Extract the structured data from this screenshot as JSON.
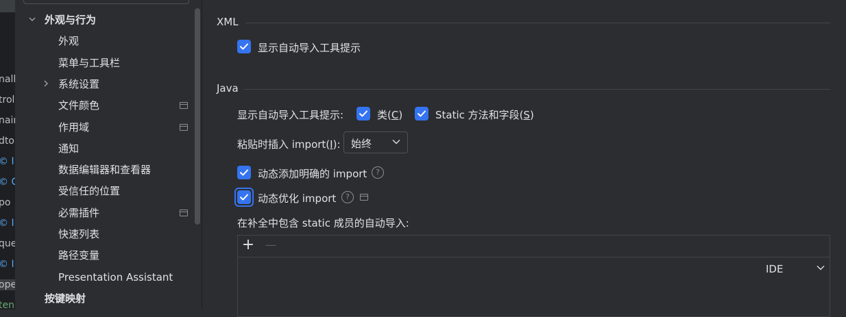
{
  "left_strip": {
    "lines": [
      "nall",
      "troll",
      "nain",
      "dto",
      "© I",
      "© C",
      "po",
      "© I",
      "que",
      "© I",
      "ope",
      "ten"
    ]
  },
  "tree": {
    "items": [
      {
        "label": "外观与行为",
        "bold": true,
        "chevron": "down",
        "indent": 0,
        "project": false
      },
      {
        "label": "外观",
        "bold": false,
        "chevron": "",
        "indent": 1,
        "project": false
      },
      {
        "label": "菜单与工具栏",
        "bold": false,
        "chevron": "",
        "indent": 1,
        "project": false
      },
      {
        "label": "系统设置",
        "bold": false,
        "chevron": "right",
        "indent": 1,
        "project": false
      },
      {
        "label": "文件颜色",
        "bold": false,
        "chevron": "",
        "indent": 1,
        "project": true
      },
      {
        "label": "作用域",
        "bold": false,
        "chevron": "",
        "indent": 1,
        "project": true
      },
      {
        "label": "通知",
        "bold": false,
        "chevron": "",
        "indent": 1,
        "project": false
      },
      {
        "label": "数据编辑器和查看器",
        "bold": false,
        "chevron": "",
        "indent": 1,
        "project": false
      },
      {
        "label": "受信任的位置",
        "bold": false,
        "chevron": "",
        "indent": 1,
        "project": false
      },
      {
        "label": "必需插件",
        "bold": false,
        "chevron": "",
        "indent": 1,
        "project": true
      },
      {
        "label": "快速列表",
        "bold": false,
        "chevron": "",
        "indent": 1,
        "project": false
      },
      {
        "label": "路径变量",
        "bold": false,
        "chevron": "",
        "indent": 1,
        "project": false
      },
      {
        "label": "Presentation Assistant",
        "bold": false,
        "chevron": "",
        "indent": 1,
        "project": false
      },
      {
        "label": "按键映射",
        "bold": true,
        "chevron": "",
        "indent": 0,
        "project": false
      }
    ]
  },
  "xml_section": {
    "title": "XML",
    "show_popup_label": "显示自动导入工具提示",
    "show_popup_checked": true
  },
  "java_section": {
    "title": "Java",
    "show_popup_label": "显示自动导入工具提示:",
    "classes_label_pre": "类(",
    "classes_mnemonic": "C",
    "classes_label_post": ")",
    "classes_checked": true,
    "static_label_pre": "Static 方法和字段(",
    "static_mnemonic": "S",
    "static_label_post": ")",
    "static_checked": true,
    "insert_on_paste_label_pre": "粘贴时插入 import(",
    "insert_on_paste_mnemonic": "I",
    "insert_on_paste_label_post": "):",
    "insert_on_paste_value": "始终",
    "add_unambiguous_label": "动态添加明确的 import",
    "add_unambiguous_checked": true,
    "optimize_label": "动态优化 import",
    "optimize_checked": true,
    "static_members_label": "在补全中包含 static 成员的自动导入:",
    "table": {
      "add_symbol": "+",
      "remove_symbol": "—",
      "rows": [
        {
          "scope": "IDE"
        }
      ]
    }
  },
  "colors": {
    "accent": "#3574f0",
    "background": "#2b2d30",
    "text": "#dfe1e5"
  }
}
